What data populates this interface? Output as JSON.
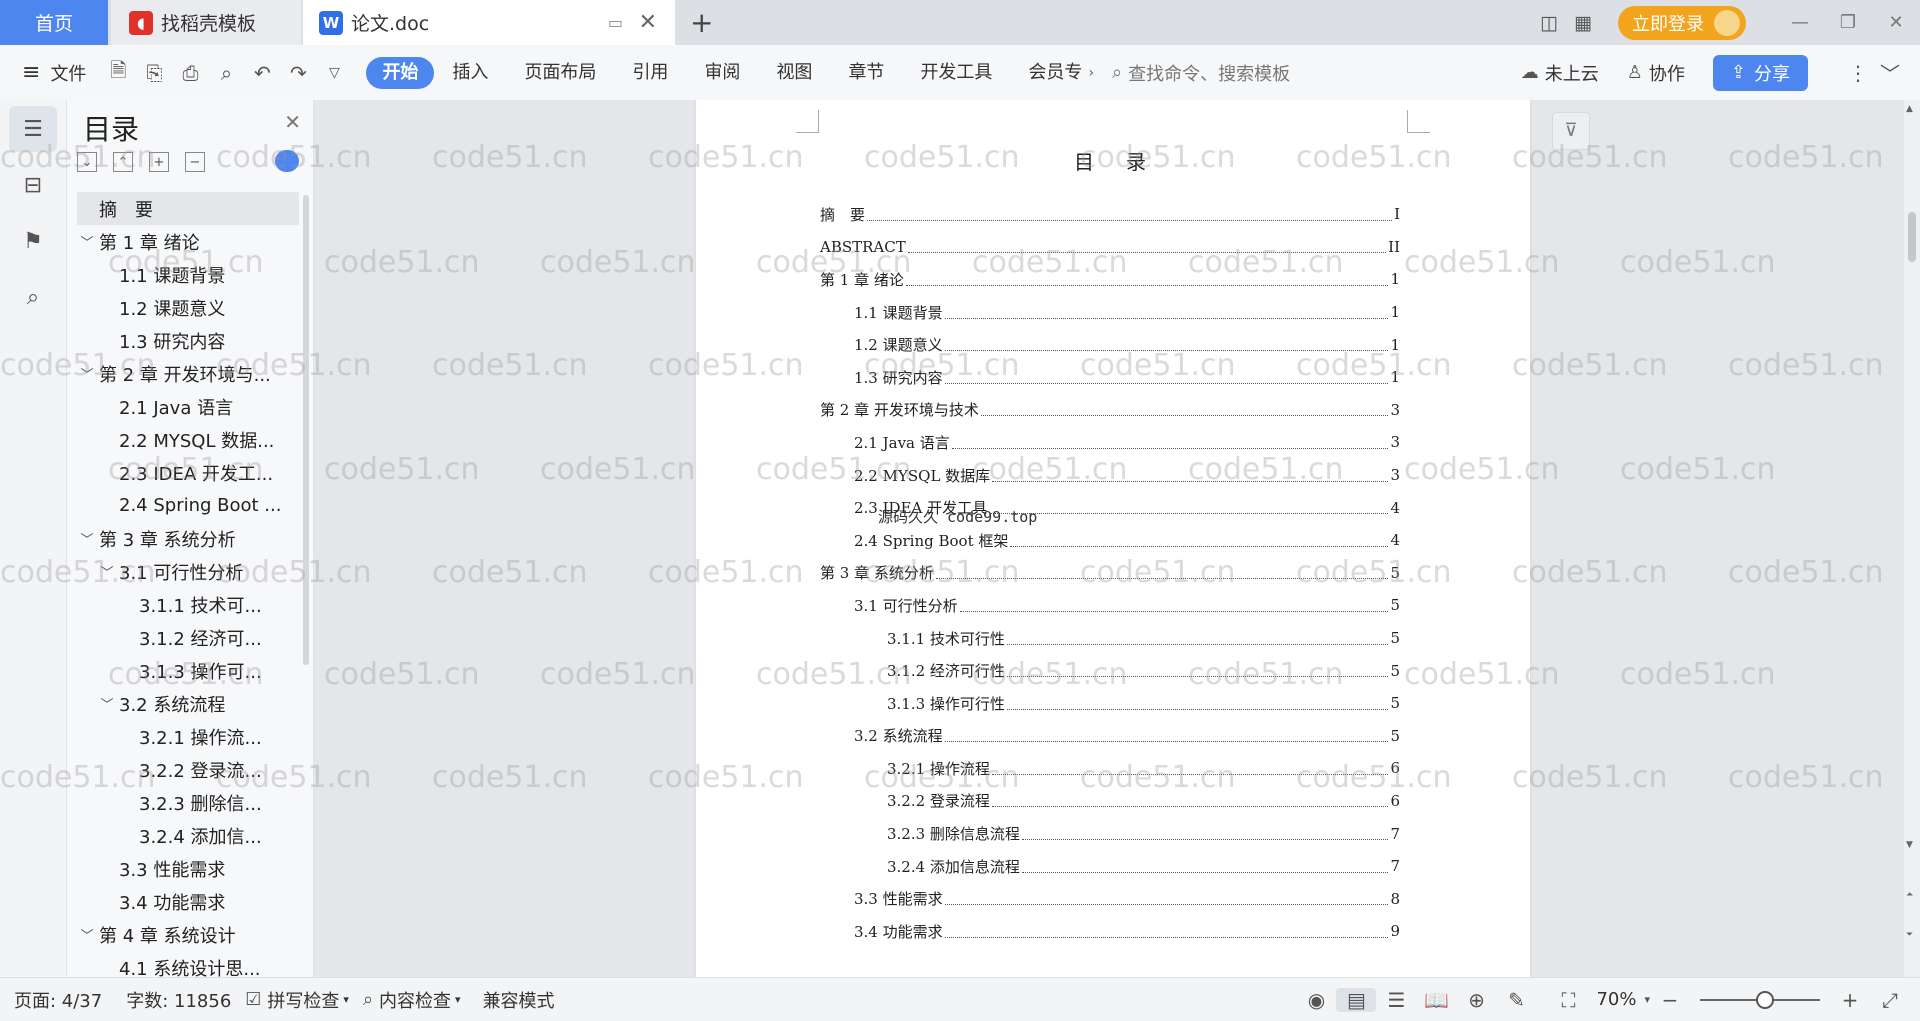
{
  "tabs": {
    "home": "首页",
    "templates": "找稻壳模板",
    "document": "论文.doc"
  },
  "topbar": {
    "login": "立即登录"
  },
  "toolbar": {
    "file": "文件",
    "tabs": [
      "开始",
      "插入",
      "页面布局",
      "引用",
      "审阅",
      "视图",
      "章节",
      "开发工具",
      "会员专"
    ],
    "search_placeholder": "查找命令、搜索模板",
    "cloud": "未上云",
    "collab": "协作",
    "share": "分享"
  },
  "sidebar": {
    "title": "目录",
    "items": [
      {
        "label": "摘　要",
        "level": 1,
        "caret": "",
        "selected": true
      },
      {
        "label": "第 1 章  绪论",
        "level": 1,
        "caret": "﹀"
      },
      {
        "label": "1.1  课题背景",
        "level": 2,
        "caret": ""
      },
      {
        "label": "1.2  课题意义",
        "level": 2,
        "caret": ""
      },
      {
        "label": "1.3  研究内容",
        "level": 2,
        "caret": ""
      },
      {
        "label": "第 2 章  开发环境与...",
        "level": 1,
        "caret": "﹀"
      },
      {
        "label": "2.1 Java 语言",
        "level": 2,
        "caret": ""
      },
      {
        "label": "2.2 MYSQL 数据...",
        "level": 2,
        "caret": ""
      },
      {
        "label": "2.3 IDEA 开发工...",
        "level": 2,
        "caret": ""
      },
      {
        "label": "2.4 Spring Boot ...",
        "level": 2,
        "caret": ""
      },
      {
        "label": "第 3 章  系统分析",
        "level": 1,
        "caret": "﹀"
      },
      {
        "label": "3.1  可行性分析",
        "level": 2,
        "caret": "﹀"
      },
      {
        "label": "3.1.1  技术可...",
        "level": 3,
        "caret": ""
      },
      {
        "label": "3.1.2  经济可...",
        "level": 3,
        "caret": ""
      },
      {
        "label": "3.1.3  操作可...",
        "level": 3,
        "caret": ""
      },
      {
        "label": "3.2  系统流程",
        "level": 2,
        "caret": "﹀"
      },
      {
        "label": "3.2.1  操作流...",
        "level": 3,
        "caret": ""
      },
      {
        "label": "3.2.2  登录流...",
        "level": 3,
        "caret": ""
      },
      {
        "label": "3.2.3  删除信...",
        "level": 3,
        "caret": ""
      },
      {
        "label": "3.2.4  添加信...",
        "level": 3,
        "caret": ""
      },
      {
        "label": "3.3  性能需求",
        "level": 2,
        "caret": ""
      },
      {
        "label": "3.4  功能需求",
        "level": 2,
        "caret": ""
      },
      {
        "label": "第 4 章  系统设计",
        "level": 1,
        "caret": "﹀"
      },
      {
        "label": "4.1  系统设计思...",
        "level": 2,
        "caret": ""
      }
    ]
  },
  "page": {
    "title": "目　录",
    "overlay": "源码久久 code99.top",
    "toc": [
      {
        "text": "摘　要",
        "page": "I",
        "level": 1
      },
      {
        "text": "ABSTRACT",
        "page": "II",
        "level": 1
      },
      {
        "text": "第 1 章  绪论",
        "page": "1",
        "level": 1
      },
      {
        "text": "1.1  课题背景",
        "page": "1",
        "level": 2
      },
      {
        "text": "1.2  课题意义",
        "page": "1",
        "level": 2
      },
      {
        "text": "1.3  研究内容",
        "page": "1",
        "level": 2
      },
      {
        "text": "第 2 章  开发环境与技术",
        "page": "3",
        "level": 1
      },
      {
        "text": "2.1 Java 语言",
        "page": "3",
        "level": 2
      },
      {
        "text": "2.2 MYSQL 数据库",
        "page": "3",
        "level": 2
      },
      {
        "text": "2.3 IDEA 开发工具",
        "page": "4",
        "level": 2
      },
      {
        "text": "2.4 Spring Boot 框架",
        "page": "4",
        "level": 2
      },
      {
        "text": "第 3 章  系统分析",
        "page": "5",
        "level": 1
      },
      {
        "text": "3.1  可行性分析",
        "page": "5",
        "level": 2
      },
      {
        "text": "3.1.1  技术可行性",
        "page": "5",
        "level": 3
      },
      {
        "text": "3.1.2  经济可行性",
        "page": "5",
        "level": 3
      },
      {
        "text": "3.1.3  操作可行性",
        "page": "5",
        "level": 3
      },
      {
        "text": "3.2  系统流程",
        "page": "5",
        "level": 2
      },
      {
        "text": "3.2.1  操作流程",
        "page": "6",
        "level": 3
      },
      {
        "text": "3.2.2  登录流程",
        "page": "6",
        "level": 3
      },
      {
        "text": "3.2.3  删除信息流程",
        "page": "7",
        "level": 3
      },
      {
        "text": "3.2.4  添加信息流程",
        "page": "7",
        "level": 3
      },
      {
        "text": "3.3  性能需求",
        "page": "8",
        "level": 2
      },
      {
        "text": "3.4  功能需求",
        "page": "9",
        "level": 2
      }
    ]
  },
  "watermark": "code51.cn",
  "status": {
    "page": "页面: 4/37",
    "words": "字数: 11856",
    "spell": "拼写检查",
    "content": "内容检查",
    "compat": "兼容模式",
    "zoom": "70%"
  }
}
